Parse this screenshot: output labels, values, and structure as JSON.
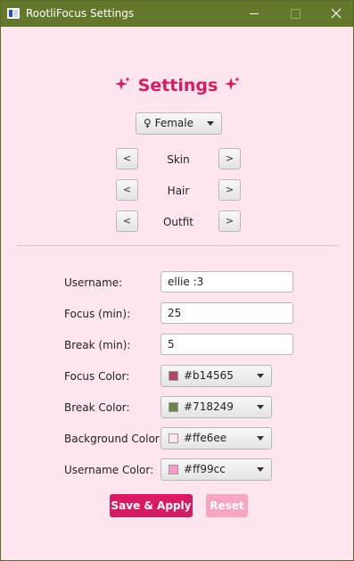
{
  "window": {
    "title": "RootliFocus Settings"
  },
  "heading": {
    "text": "Settings"
  },
  "character": {
    "gender_selected": "♀ Female",
    "categories": [
      {
        "label": "Skin",
        "prev": "<",
        "next": ">"
      },
      {
        "label": "Hair",
        "prev": "<",
        "next": ">"
      },
      {
        "label": "Outfit",
        "prev": "<",
        "next": ">"
      }
    ]
  },
  "form": {
    "username": {
      "label": "Username:",
      "value": "ellie :3"
    },
    "focus": {
      "label": "Focus (min):",
      "value": "25"
    },
    "break": {
      "label": "Break (min):",
      "value": "5"
    },
    "focus_color": {
      "label": "Focus Color:",
      "value": "#b14565",
      "color": "#b14565"
    },
    "break_color": {
      "label": "Break Color:",
      "value": "#718249",
      "color": "#718249"
    },
    "background_color": {
      "label": "Background Color:",
      "value": "#ffe6ee",
      "color": "#ffe6ee"
    },
    "username_color": {
      "label": "Username Color:",
      "value": "#ff99cc",
      "color": "#ff99cc"
    }
  },
  "actions": {
    "save_label": "Save & Apply",
    "reset_label": "Reset"
  },
  "theme": {
    "titlebar": "#63782b",
    "background": "#ffe6ee",
    "accent": "#d81b60",
    "accent_disabled": "#f7a6c2"
  }
}
